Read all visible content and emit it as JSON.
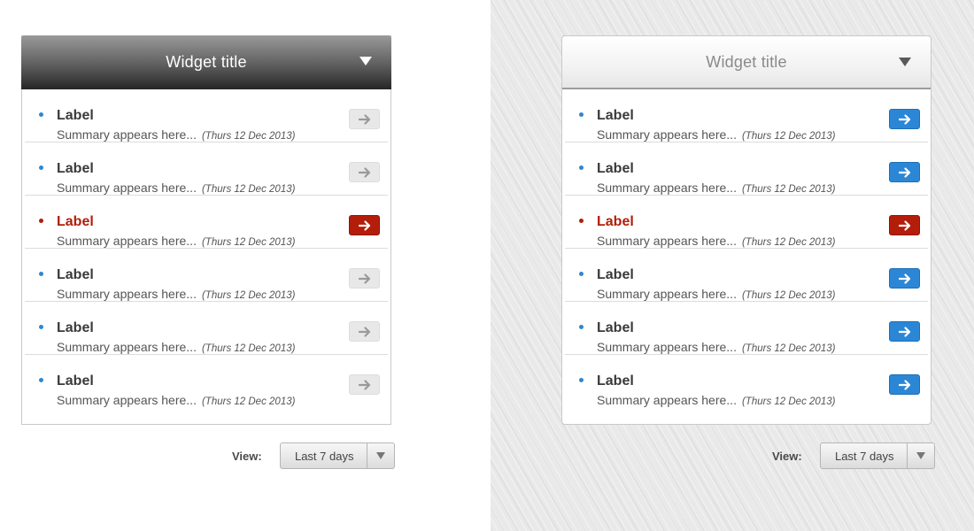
{
  "colors": {
    "accent_blue": "#2f86d2",
    "button_blue": "#2b87d6",
    "alert_red": "#b31d0a",
    "dark_header": "#262626"
  },
  "dark_widget": {
    "title": "Widget title",
    "toggle_icon": "triangle-down-icon",
    "items": [
      {
        "label": "Label",
        "summary": "Summary appears here...",
        "date": "(Thurs 12 Dec 2013)",
        "active": false
      },
      {
        "label": "Label",
        "summary": "Summary appears here...",
        "date": "(Thurs 12 Dec 2013)",
        "active": false
      },
      {
        "label": "Label",
        "summary": "Summary appears here...",
        "date": "(Thurs 12 Dec 2013)",
        "active": true
      },
      {
        "label": "Label",
        "summary": "Summary appears here...",
        "date": "(Thurs 12 Dec 2013)",
        "active": false
      },
      {
        "label": "Label",
        "summary": "Summary appears here...",
        "date": "(Thurs 12 Dec 2013)",
        "active": false
      },
      {
        "label": "Label",
        "summary": "Summary appears here...",
        "date": "(Thurs 12 Dec 2013)",
        "active": false
      }
    ],
    "view": {
      "label": "View:",
      "selected": "Last 7 days"
    }
  },
  "light_widget": {
    "title": "Widget title",
    "toggle_icon": "triangle-down-icon",
    "items": [
      {
        "label": "Label",
        "summary": "Summary appears here...",
        "date": "(Thurs 12 Dec 2013)",
        "active": false
      },
      {
        "label": "Label",
        "summary": "Summary appears here...",
        "date": "(Thurs 12 Dec 2013)",
        "active": false
      },
      {
        "label": "Label",
        "summary": "Summary appears here...",
        "date": "(Thurs 12 Dec 2013)",
        "active": true
      },
      {
        "label": "Label",
        "summary": "Summary appears here...",
        "date": "(Thurs 12 Dec 2013)",
        "active": false
      },
      {
        "label": "Label",
        "summary": "Summary appears here...",
        "date": "(Thurs 12 Dec 2013)",
        "active": false
      },
      {
        "label": "Label",
        "summary": "Summary appears here...",
        "date": "(Thurs 12 Dec 2013)",
        "active": false
      }
    ],
    "view": {
      "label": "View:",
      "selected": "Last 7 days"
    }
  }
}
